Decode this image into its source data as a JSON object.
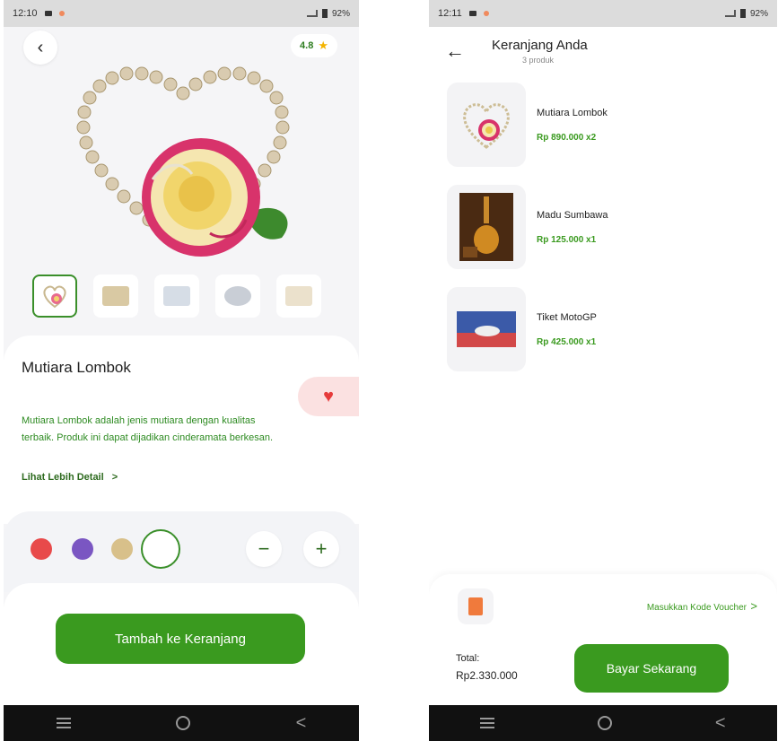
{
  "left_screen": {
    "status": {
      "time": "12:10",
      "battery": "92%"
    },
    "rating": "4.8",
    "product": {
      "name": "Mutiara Lombok",
      "description": "Mutiara Lombok adalah jenis mutiara dengan kualitas terbaik. Produk ini dapat dijadikan cinderamata berkesan.",
      "more_link": "Lihat Lebih Detail",
      "more_chevron": ">"
    },
    "colors": [
      "#e84a4a",
      "#7a56c2",
      "#d8c08a",
      "#ffffff"
    ],
    "qty": {
      "minus": "−",
      "plus": "+"
    },
    "add_to_cart_label": "Tambah ke Keranjang",
    "icons": {
      "back": "chevron-left-icon",
      "star": "star-icon",
      "favorite": "heart-icon"
    }
  },
  "right_screen": {
    "status": {
      "time": "12:11",
      "battery": "92%"
    },
    "title": "Keranjang Anda",
    "subtitle": "3 produk",
    "items": [
      {
        "name": "Mutiara Lombok",
        "price": "Rp 890.000 x2"
      },
      {
        "name": "Madu Sumbawa",
        "price": "Rp 125.000 x1"
      },
      {
        "name": "Tiket MotoGP",
        "price": "Rp 425.000 x1"
      }
    ],
    "voucher_label": "Masukkan Kode Voucher",
    "voucher_chevron": ">",
    "total_label": "Total:",
    "total_value": "Rp2.330.000",
    "pay_label": "Bayar Sekarang"
  },
  "navbar": {
    "back_glyph": "<"
  }
}
